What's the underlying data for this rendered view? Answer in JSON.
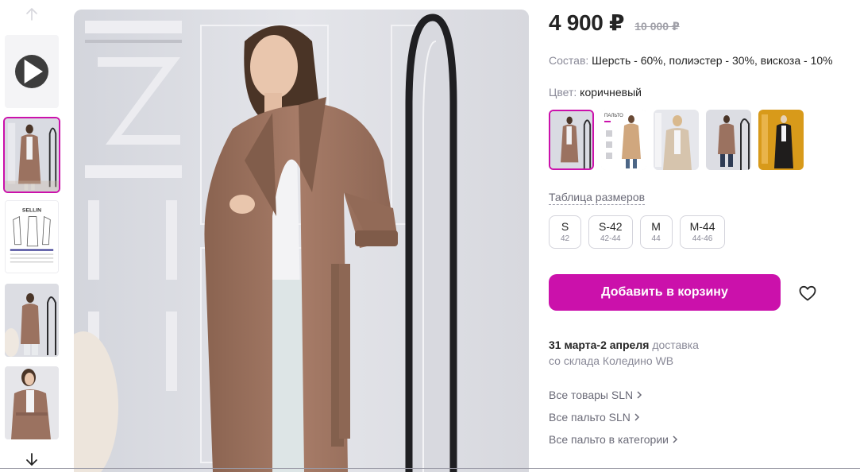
{
  "product": {
    "price": "4 900 ₽",
    "old_price": "10 000 ₽",
    "composition_label": "Состав:",
    "composition_value": "Шерсть - 60%, полиэстер - 30%, вискоза - 10%",
    "color_label": "Цвет:",
    "color_value": "коричневый",
    "size_table_link": "Таблица размеров",
    "sizes": [
      {
        "label": "S",
        "sub": "42"
      },
      {
        "label": "S-42",
        "sub": "42-44"
      },
      {
        "label": "M",
        "sub": "44"
      },
      {
        "label": "M-44",
        "sub": "44-46"
      }
    ],
    "add_to_cart": "Добавить в корзину",
    "delivery_dates": "31 марта-2 апреля",
    "delivery_word": "доставка",
    "delivery_from": "со склада Коледино WB"
  },
  "links": {
    "all_brand": "Все товары SLN",
    "all_coats_brand": "Все пальто SLN",
    "all_coats_category": "Все пальто в категории"
  },
  "gallery": {
    "thumb_brand_text": "SELLIN",
    "thumb_title_text": "ПАЛЬТО"
  },
  "colors": {
    "accent": "#cb11ab",
    "coat": "#9b7260",
    "price_old": "#a0a0a8"
  },
  "icons": {
    "up": "arrow-up-icon",
    "down": "arrow-down-icon",
    "play": "play-icon",
    "favorite": "heart-icon",
    "chevron": "chevron-right-icon"
  }
}
